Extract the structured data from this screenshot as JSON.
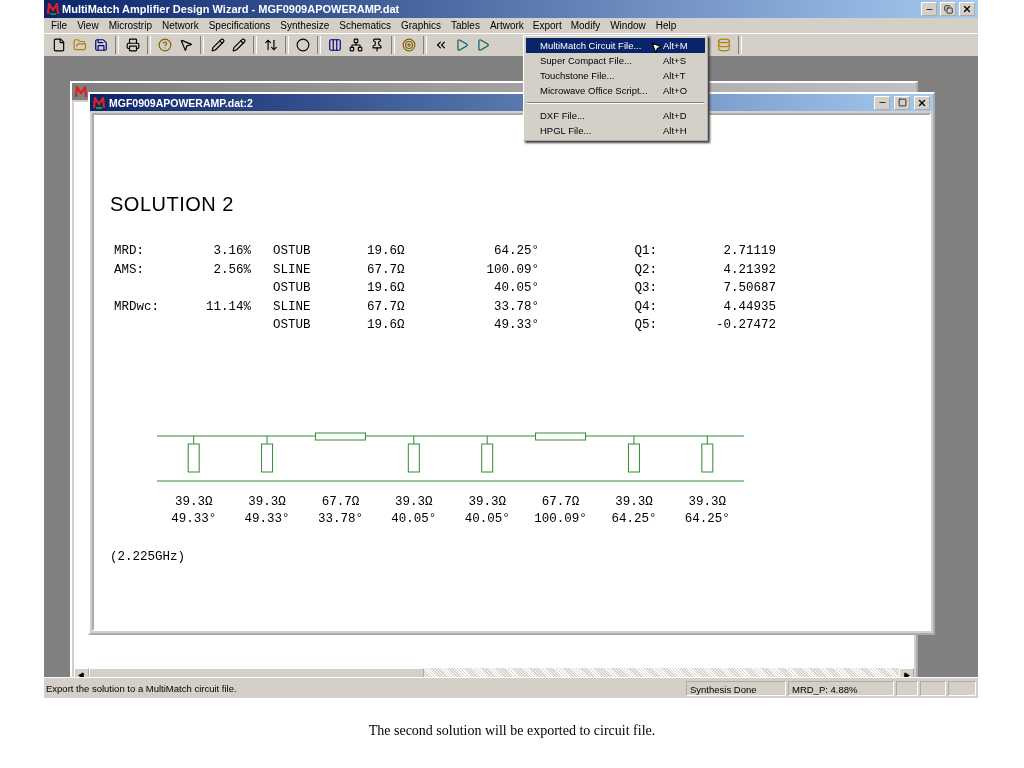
{
  "window": {
    "title": "MultiMatch Amplifier Design Wizard - MGF0909APOWERAMP.dat"
  },
  "menu": [
    {
      "label": "File",
      "selected": false
    },
    {
      "label": "View",
      "selected": false
    },
    {
      "label": "Microstrip",
      "selected": false
    },
    {
      "label": "Network",
      "selected": false
    },
    {
      "label": "Specifications",
      "selected": false
    },
    {
      "label": "Synthesize",
      "selected": false
    },
    {
      "label": "Schematics",
      "selected": false
    },
    {
      "label": "Graphics",
      "selected": false
    },
    {
      "label": "Tables",
      "selected": false
    },
    {
      "label": "Artwork",
      "selected": false
    },
    {
      "label": "Export",
      "selected": true
    },
    {
      "label": "Modify",
      "selected": false
    },
    {
      "label": "Window",
      "selected": false
    },
    {
      "label": "Help",
      "selected": false
    }
  ],
  "export_menu": {
    "groups": [
      {
        "items": [
          {
            "label": "MultiMatch Circuit File...",
            "shortcut": "Alt+M",
            "selected": true
          },
          {
            "label": "Super Compact File...",
            "shortcut": "Alt+S",
            "selected": false
          },
          {
            "label": "Touchstone File...",
            "shortcut": "Alt+T",
            "selected": false
          },
          {
            "label": "Microwave Office Script...",
            "shortcut": "Alt+O",
            "selected": false
          }
        ]
      },
      {
        "items": [
          {
            "label": "DXF File...",
            "shortcut": "Alt+D",
            "selected": false
          },
          {
            "label": "HPGL File...",
            "shortcut": "Alt+H",
            "selected": false
          }
        ]
      }
    ]
  },
  "document": {
    "title": "MGF0909APOWERAMP.dat:2",
    "heading": "SOLUTION 2",
    "rows": [
      {
        "metric_label": "MRD:",
        "metric_value": "3.16%",
        "element": "OSTUB",
        "impedance": "19.6Ω",
        "angle": "64.25°",
        "q_label": "Q1:",
        "q_value": "2.71119"
      },
      {
        "metric_label": "AMS:",
        "metric_value": "2.56%",
        "element": "SLINE",
        "impedance": "67.7Ω",
        "angle": "100.09°",
        "q_label": "Q2:",
        "q_value": "4.21392"
      },
      {
        "element": "OSTUB",
        "impedance": "19.6Ω",
        "angle": "40.05°",
        "q_label": "Q3:",
        "q_value": "7.50687"
      },
      {
        "metric_label": "MRDwc:",
        "metric_value": "11.14%",
        "element": "SLINE",
        "impedance": "67.7Ω",
        "angle": "33.78°",
        "q_label": "Q4:",
        "q_value": "4.44935"
      },
      {
        "element": "OSTUB",
        "impedance": "19.6Ω",
        "angle": "49.33°",
        "q_label": "Q5:",
        "q_value": "-0.27472"
      }
    ],
    "circuit": [
      {
        "kind": "stub",
        "impedance": "39.3Ω",
        "angle": "49.33°"
      },
      {
        "kind": "stub",
        "impedance": "39.3Ω",
        "angle": "49.33°"
      },
      {
        "kind": "line",
        "impedance": "67.7Ω",
        "angle": "33.78°"
      },
      {
        "kind": "stub",
        "impedance": "39.3Ω",
        "angle": "40.05°"
      },
      {
        "kind": "stub",
        "impedance": "39.3Ω",
        "angle": "40.05°"
      },
      {
        "kind": "line",
        "impedance": "67.7Ω",
        "angle": "100.09°"
      },
      {
        "kind": "stub",
        "impedance": "39.3Ω",
        "angle": "64.25°"
      },
      {
        "kind": "stub",
        "impedance": "39.3Ω",
        "angle": "64.25°"
      }
    ],
    "frequency": "(2.225GHz)"
  },
  "status_bar": {
    "message": "Export the solution to a MultiMatch circuit file.",
    "panels": [
      "Synthesis Done",
      "MRD_P: 4.88%"
    ]
  },
  "caption": "The second solution will be exported to circuit file."
}
